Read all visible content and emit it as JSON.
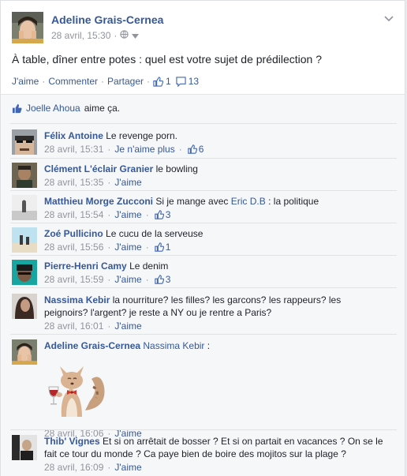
{
  "post": {
    "author": "Adeline Grais-Cernea",
    "date": "28 avril, 15:30",
    "dot": "·",
    "text": "À table, dîner entre potes : quel est votre sujet de prédilection ?",
    "actions": {
      "like": "J'aime",
      "comment": "Commenter",
      "share": "Partager",
      "sep": "·",
      "like_count": "1",
      "comment_count": "13"
    }
  },
  "likes": {
    "name": "Joelle Ahoua",
    "suffix": "aime ça."
  },
  "comments": [
    {
      "name": "Félix Antoine",
      "text": "Le revenge porn.",
      "date": "28 avril, 15:31",
      "action": "Je n'aime plus",
      "likes": "6"
    },
    {
      "name": "Clément L'éclair Granier",
      "text": "le bowling",
      "date": "28 avril, 15:35",
      "action": "J'aime",
      "likes": ""
    },
    {
      "name": "Matthieu Morge Zucconi",
      "pre": "Si je mange avec",
      "mention": "Eric D.B",
      "text": ": la politique",
      "date": "28 avril, 15:54",
      "action": "J'aime",
      "likes": "3"
    },
    {
      "name": "Zoé Pullicino",
      "text": "Le cucu de la serveuse",
      "date": "28 avril, 15:56",
      "action": "J'aime",
      "likes": "1"
    },
    {
      "name": "Pierre-Henri Camy",
      "text": "Le denim",
      "date": "28 avril, 15:59",
      "action": "J'aime",
      "likes": "3"
    },
    {
      "name": "Nassima Kebir",
      "text1": "la nourriture? les filles? les garcons? les rappeurs? les",
      "text2": "peignoirs? l'argent? je reste a NY ou je rentre a Paris?",
      "date": "28 avril, 16:01",
      "action": "J'aime",
      "likes": ""
    },
    {
      "name": "Adeline Grais-Cernea",
      "mention": "Nassima Kebir",
      "text": ":",
      "date": "28 avril, 16:06",
      "action": "J'aime",
      "likes": ""
    },
    {
      "name": "Thib' Vignes",
      "text1": "Et si on arrêtait de bosser ? Et si on partait en vacances ? On se le",
      "text2": "fait ce tour du monde ? Ca paye bien de boire des mojitos sur la plage ?",
      "date": "28 avril, 16:09",
      "action": "J'aime",
      "likes": ""
    }
  ],
  "icons": {
    "globe": "globe-icon",
    "chevron": "chevron-down-icon",
    "thumb": "thumbs-up-icon",
    "speech": "comment-bubble-icon"
  },
  "colors": {
    "link": "#365899",
    "meta": "#90949c",
    "ufi_bg": "#f6f7f9"
  }
}
